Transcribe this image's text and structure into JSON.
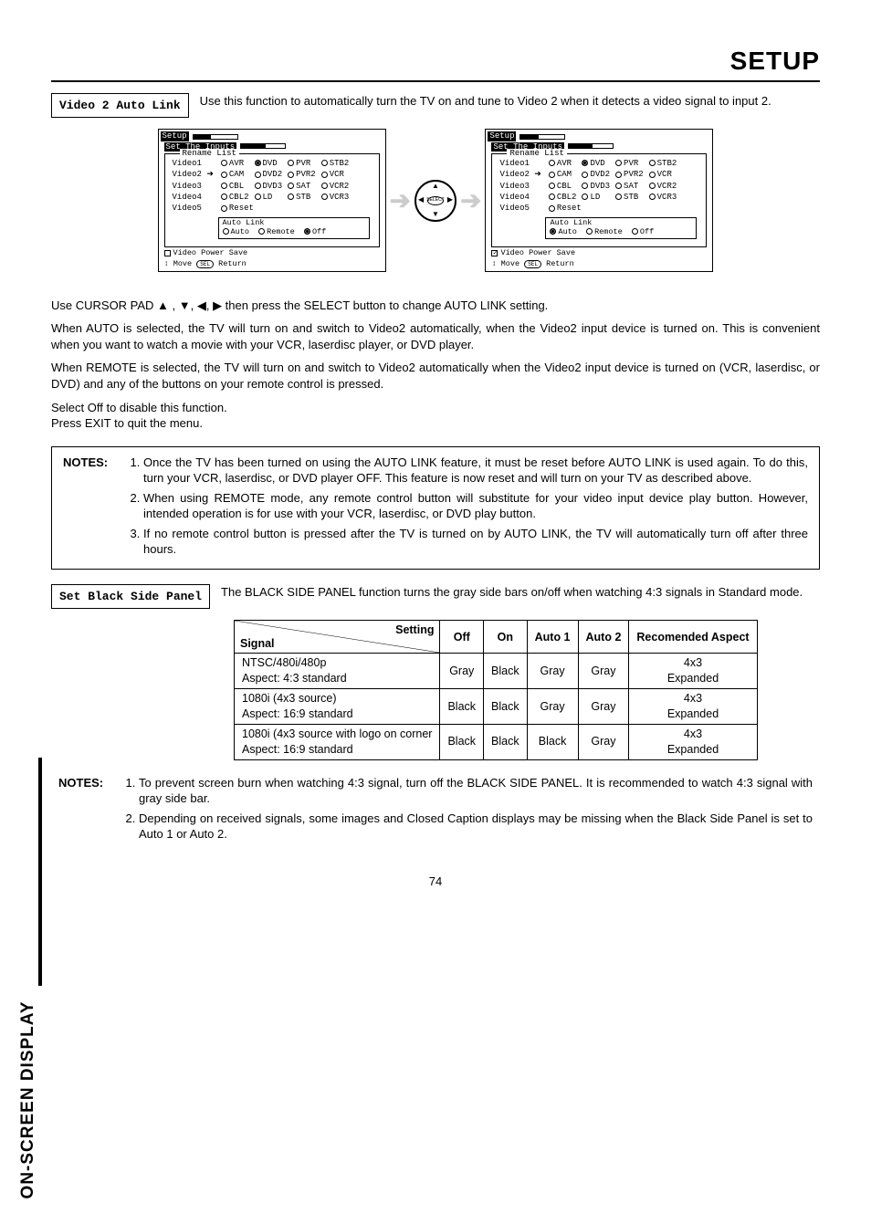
{
  "header": {
    "title": "SETUP"
  },
  "side_tab": "ON-SCREEN DISPLAY",
  "page_number": "74",
  "section1": {
    "label": "Video 2 Auto Link",
    "intro": "Use this function to automatically turn the TV on and tune to Video 2 when it detects a video signal to input 2."
  },
  "osd": {
    "title": "Setup",
    "subtitle": "Set The Inputs",
    "group_label": "Rename List",
    "rows": [
      "Video1",
      "Video2",
      "Video3",
      "Video4",
      "Video5"
    ],
    "opts_row1": [
      "AVR",
      "DVD",
      "PVR",
      "STB2"
    ],
    "opts_row2": [
      "CAM",
      "DVD2",
      "PVR2",
      "VCR"
    ],
    "opts_row3": [
      "CBL",
      "DVD3",
      "SAT",
      "VCR2"
    ],
    "opts_row4": [
      "CBL2",
      "LD",
      "STB",
      "VCR3"
    ],
    "opts_row5_single": "Reset",
    "auto_link_label": "Auto Link",
    "auto_link_opts": [
      "Auto",
      "Remote",
      "Off"
    ],
    "left_selected_auto": 2,
    "right_selected_auto": 0,
    "left_dvd_selected": true,
    "right_dvd_selected": true,
    "foot1": "Video Power Save",
    "foot2_icon": "↕",
    "foot2_label": "Move",
    "foot2_btn": "SEL",
    "foot2_ret": "Return",
    "dpad_center": "SELECT"
  },
  "paragraphs": {
    "p1": "Use CURSOR PAD ▲ , ▼, ◀, ▶ then press the SELECT button to change AUTO LINK setting.",
    "p2": "When AUTO  is selected, the TV will turn on and switch to Video2 automatically, when the Video2 input device is turned on. This is convenient when you want to watch a movie with your VCR, laserdisc player, or DVD player.",
    "p3": "When REMOTE is selected, the TV will turn on and switch to Video2 automatically when the Video2 input device is turned on (VCR, laserdisc, or DVD) and any of the buttons on your remote control is pressed.",
    "p4": "Select Off to disable this function.",
    "p5": "Press EXIT to quit the menu."
  },
  "notes1": {
    "label": "NOTES:",
    "items": [
      "Once the TV has been turned on using the AUTO LINK feature, it must be reset before AUTO LINK is used again. To do this, turn your VCR, laserdisc, or DVD player OFF. This feature is now reset and will turn on your TV as described above.",
      "When using REMOTE mode, any remote control button will substitute for your video input device play button. However, intended operation is for use with your VCR, laserdisc, or DVD play button.",
      "If no remote control button is pressed after the TV is turned on by AUTO LINK, the TV will automatically turn off after three hours."
    ]
  },
  "section2": {
    "label": "Set Black Side Panel",
    "intro": "The BLACK SIDE PANEL function turns the gray side bars on/off when watching 4:3 signals in Standard mode."
  },
  "table": {
    "header_setting": "Setting",
    "header_signal": "Signal",
    "cols": [
      "Off",
      "On",
      "Auto 1",
      "Auto 2",
      "Recomended Aspect"
    ],
    "rows": [
      {
        "sig": "NTSC/480i/480p\nAspect: 4:3 standard",
        "vals": [
          "Gray",
          "Black",
          "Gray",
          "Gray",
          "4x3\nExpanded"
        ]
      },
      {
        "sig": "1080i (4x3 source)\nAspect: 16:9 standard",
        "vals": [
          "Black",
          "Black",
          "Gray",
          "Gray",
          "4x3\nExpanded"
        ]
      },
      {
        "sig": "1080i (4x3 source with logo on corner\nAspect: 16:9 standard",
        "vals": [
          "Black",
          "Black",
          "Black",
          "Gray",
          "4x3\nExpanded"
        ]
      }
    ]
  },
  "notes2": {
    "label": "NOTES:",
    "items": [
      "To prevent screen burn when watching 4:3 signal, turn off the BLACK SIDE PANEL.  It is recommended to watch 4:3 signal with gray side bar.",
      "Depending on received signals, some images and Closed Caption displays may be missing when the Black Side Panel is set to Auto 1 or Auto 2."
    ]
  }
}
